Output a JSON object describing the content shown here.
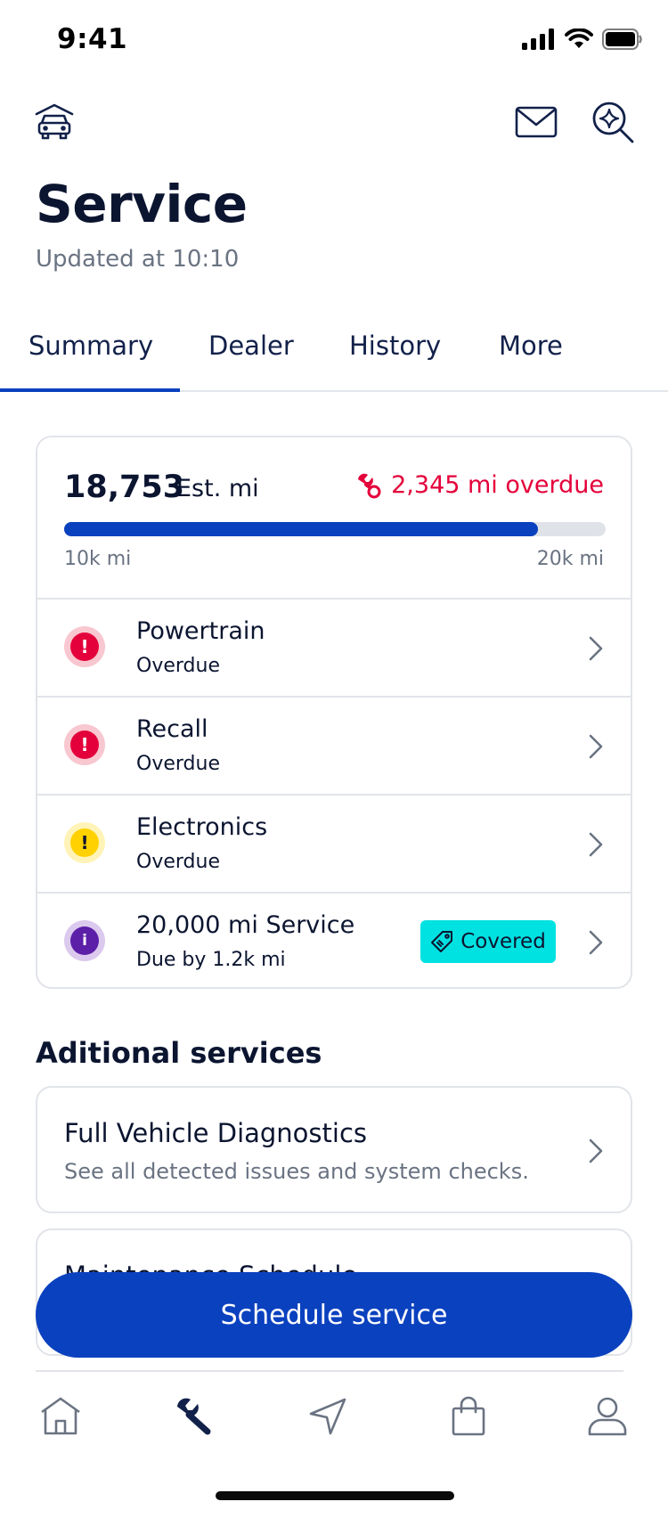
{
  "status_bar": {
    "time": "9:41"
  },
  "header": {
    "title": "Service",
    "updated": "Updated at 10:10"
  },
  "tabs": [
    {
      "label": "Summary",
      "active": true
    },
    {
      "label": "Dealer"
    },
    {
      "label": "History"
    },
    {
      "label": "More"
    }
  ],
  "mileage": {
    "value": "18,753",
    "unit": "Est. mi",
    "overdue": "2,345 mi overdue",
    "range_min": "10k mi",
    "range_max": "20k mi",
    "progress_fraction": 0.875
  },
  "service_items": [
    {
      "title": "Powertrain",
      "status": "Overdue",
      "level": "error"
    },
    {
      "title": "Recall",
      "status": "Overdue",
      "level": "error"
    },
    {
      "title": "Electronics",
      "status": "Overdue",
      "level": "warning"
    },
    {
      "title": "20,000 mi Service",
      "status": "Due by 1.2k mi",
      "level": "info",
      "tag": "Covered"
    }
  ],
  "additional": {
    "heading": "Aditional services",
    "items": [
      {
        "title": "Full Vehicle Diagnostics",
        "subtitle": "See all detected issues and system checks."
      },
      {
        "title": "Maintenance Schedule",
        "subtitle": ""
      }
    ]
  },
  "cta": {
    "label": "Schedule service"
  },
  "colors": {
    "primary": "#0a41bf",
    "error": "#e4003a",
    "warning": "#ffd100",
    "info": "#5c1fa8",
    "covered": "#00e1e1"
  }
}
